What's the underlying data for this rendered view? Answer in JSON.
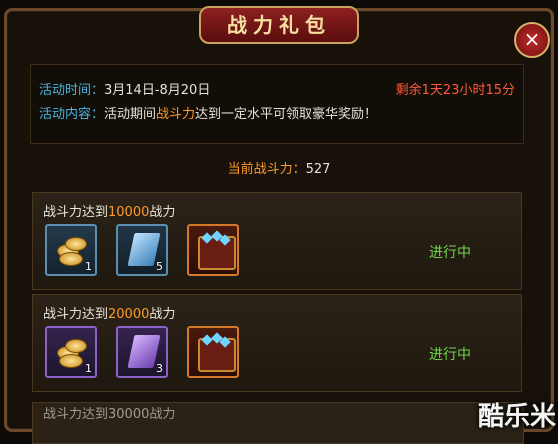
{
  "dialog": {
    "title": "战力礼包",
    "close_icon": "×"
  },
  "info": {
    "time_label": "活动时间：",
    "time_value": "3月14日-8月20日",
    "remaining": "剩余1天23小时15分",
    "content_label": "活动内容：",
    "content_pre": "活动期间",
    "content_highlight": "战斗力",
    "content_post": "达到一定水平可领取豪华奖励！"
  },
  "current": {
    "label": "当前战斗力：",
    "value": "527"
  },
  "tasks": [
    {
      "title_pre": "战斗力达到",
      "target": "10000",
      "title_post": "战力",
      "status": "进行中",
      "items": [
        {
          "icon": "gold-coins-icon",
          "count": "1"
        },
        {
          "icon": "blue-book-icon",
          "count": "5"
        },
        {
          "icon": "treasure-chest-icon",
          "count": ""
        }
      ]
    },
    {
      "title_pre": "战斗力达到",
      "target": "20000",
      "title_post": "战力",
      "status": "进行中",
      "items": [
        {
          "icon": "gold-coins-icon",
          "count": "1"
        },
        {
          "icon": "purple-book-icon",
          "count": "3"
        },
        {
          "icon": "treasure-chest-icon",
          "count": ""
        }
      ]
    },
    {
      "title_pre": "战斗力达到",
      "target": "30000",
      "title_post": "战力"
    }
  ],
  "watermark": "酷乐米",
  "colors": {
    "label_blue": "#4cb4e0",
    "highlight_orange": "#ff9a2a",
    "remaining_red": "#ff5a3a",
    "status_green": "#6fd34a",
    "title_red": "#8e2020"
  }
}
